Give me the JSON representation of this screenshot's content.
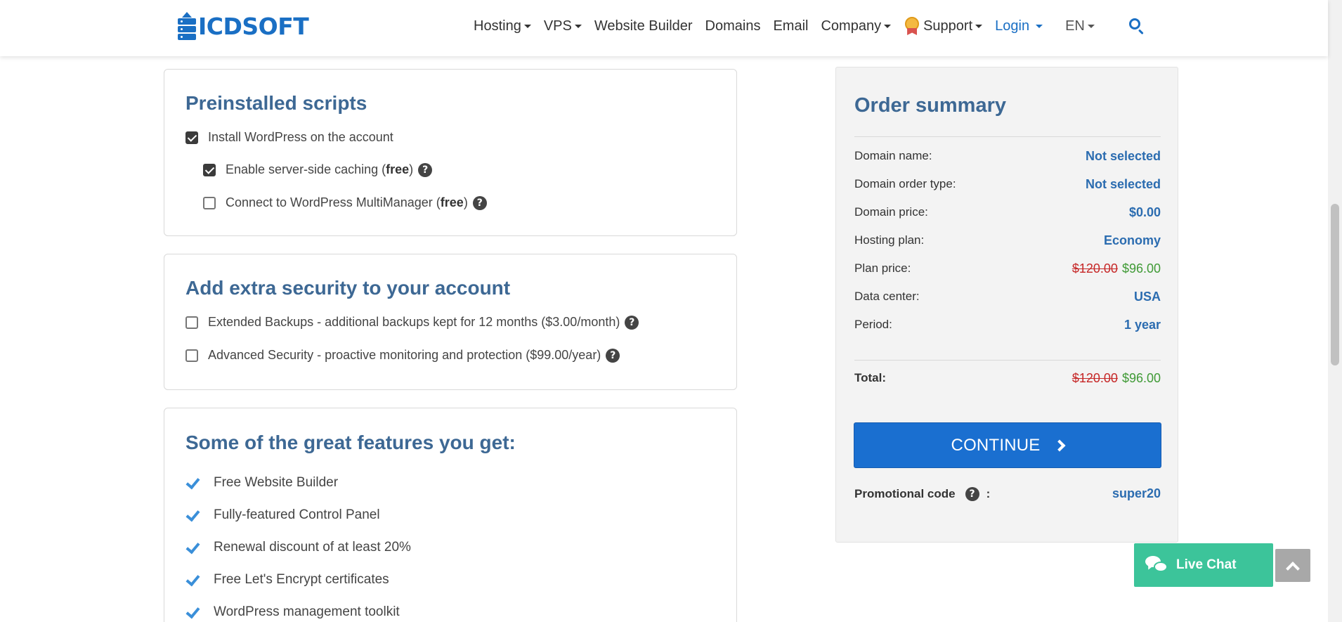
{
  "header": {
    "logo_text": "ICDSOFT",
    "nav": [
      {
        "label": "Hosting"
      },
      {
        "label": "VPS"
      },
      {
        "label": "Website Builder"
      },
      {
        "label": "Domains"
      },
      {
        "label": "Email"
      },
      {
        "label": "Company"
      },
      {
        "label": "Support"
      }
    ],
    "login_label": "Login",
    "lang_label": "EN"
  },
  "preinstalled": {
    "title": "Preinstalled scripts",
    "options": [
      {
        "label": "Install WordPress on the account",
        "checked": true
      },
      {
        "label_prefix": "Enable server-side caching (",
        "label_bold": "free",
        "label_suffix": ")",
        "checked": true
      },
      {
        "label_prefix": "Connect to WordPress MultiManager (",
        "label_bold": "free",
        "label_suffix": ")",
        "checked": false
      }
    ]
  },
  "security": {
    "title": "Add extra security to your account",
    "options": [
      {
        "label": "Extended Backups - additional backups kept for 12 months ($3.00/month)",
        "checked": false
      },
      {
        "label": "Advanced Security - proactive monitoring and protection ($99.00/year)",
        "checked": false
      }
    ]
  },
  "features": {
    "title": "Some of the great features you get:",
    "items": [
      "Free Website Builder",
      "Fully-featured Control Panel",
      "Renewal discount of at least 20%",
      "Free Let's Encrypt certificates",
      "WordPress management toolkit"
    ]
  },
  "summary": {
    "title": "Order summary",
    "rows": [
      {
        "label": "Domain name:",
        "value": "Not selected"
      },
      {
        "label": "Domain order type:",
        "value": "Not selected"
      },
      {
        "label": "Domain price:",
        "value": "$0.00"
      },
      {
        "label": "Hosting plan:",
        "value": "Economy"
      },
      {
        "label": "Plan price:",
        "old": "$120.00",
        "new": "$96.00"
      },
      {
        "label": "Data center:",
        "value": "USA"
      },
      {
        "label": "Period:",
        "value": "1 year"
      }
    ],
    "total": {
      "label": "Total:",
      "old": "$120.00",
      "new": "$96.00"
    },
    "continue_label": "CONTINUE",
    "promo_label": "Promotional code",
    "promo_colon": ":",
    "promo_value": "super20"
  },
  "live_chat_label": "Live Chat",
  "colors": {
    "brand": "#1a6fc4",
    "heading": "#3d6894",
    "button": "#1a6fd0",
    "old_price": "#c62828",
    "new_price": "#3f9a35",
    "live_chat": "#3cc49a"
  }
}
